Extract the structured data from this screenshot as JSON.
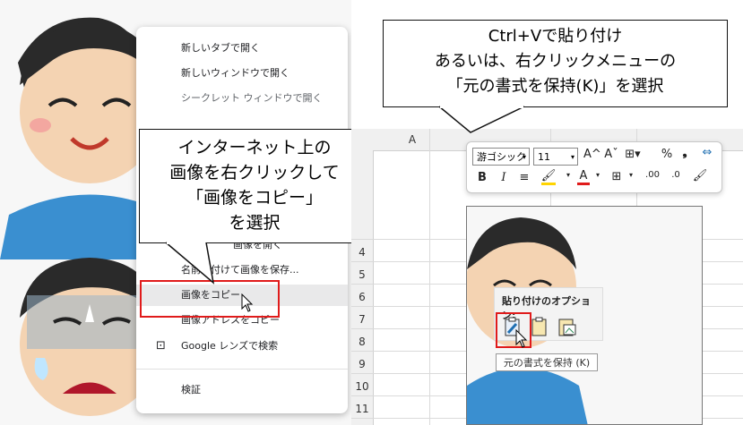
{
  "context_menu": {
    "items_top": [
      {
        "label": "新しいタブで開く"
      },
      {
        "label": "新しいウィンドウで開く"
      },
      {
        "label": "シークレット ウィンドウで開く"
      }
    ],
    "item_open_image": "画像を開く",
    "item_save_image": "名前を付けて画像を保存...",
    "item_copy_image": "画像をコピー",
    "item_copy_address": "画像アドレスをコピー",
    "item_google_lens": "Google レンズで検索",
    "item_inspect": "検証"
  },
  "callouts": {
    "left": [
      "インターネット上の",
      "画像を右クリックして",
      "「画像をコピー」",
      "を選択"
    ],
    "right": [
      "Ctrl+Vで貼り付け",
      "あるいは、右クリックメニューの",
      "「元の書式を保持(K)」を選択"
    ]
  },
  "excel": {
    "column_a": "A",
    "row_numbers": [
      "4",
      "5",
      "6",
      "7",
      "8",
      "9",
      "10",
      "11"
    ],
    "font_name": "游ゴシック",
    "font_size": "11",
    "paste_options_title": "貼り付けのオプション:",
    "tooltip": "元の書式を保持 (K)",
    "toolbar": {
      "grow": "A^",
      "shrink": "Aˇ",
      "percent": "%",
      "comma": "❟",
      "bold": "B",
      "italic": "I",
      "align": "≡",
      "font_color": "A",
      "dec_inc": ".00",
      "dec_dec": ".0"
    }
  },
  "colors": {
    "highlight_red": "#e01b1b",
    "fill_yellow": "#ffd400",
    "font_red": "#e01b1b"
  }
}
